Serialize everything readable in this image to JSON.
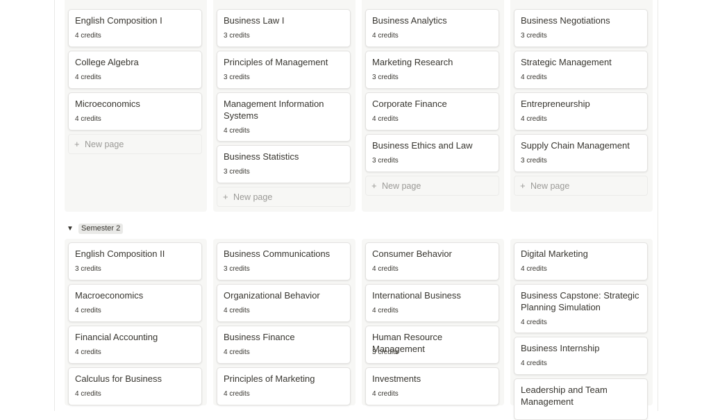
{
  "group2": {
    "label": "Semester 2"
  },
  "new_page_label": "New page",
  "semester1": {
    "col1": [
      {
        "title": "English Composition I",
        "credits": "4 credits"
      },
      {
        "title": "College Algebra",
        "credits": "4 credits"
      },
      {
        "title": "Microeconomics",
        "credits": "4 credits"
      }
    ],
    "col2": [
      {
        "title": "Business Law I",
        "credits": "3 credits"
      },
      {
        "title": "Principles of Management",
        "credits": "3 credits"
      },
      {
        "title": "Management Information Systems",
        "credits": "4 credits"
      },
      {
        "title": "Business Statistics",
        "credits": "3 credits"
      }
    ],
    "col3": [
      {
        "title": "Business Analytics",
        "credits": "4 credits"
      },
      {
        "title": "Marketing Research",
        "credits": "3 credits"
      },
      {
        "title": "Corporate Finance",
        "credits": "4 credits"
      },
      {
        "title": "Business Ethics and Law",
        "credits": "3 credits"
      }
    ],
    "col4": [
      {
        "title": "Business Negotiations",
        "credits": "3 credits"
      },
      {
        "title": "Strategic Management",
        "credits": "4 credits"
      },
      {
        "title": "Entrepreneurship",
        "credits": "4 credits"
      },
      {
        "title": "Supply Chain Management",
        "credits": "3 credits"
      }
    ]
  },
  "semester2": {
    "col1": [
      {
        "title": "English Composition II",
        "credits": "3 credits"
      },
      {
        "title": "Macroeconomics",
        "credits": "4 credits"
      },
      {
        "title": "Financial Accounting",
        "credits": "4 credits"
      },
      {
        "title": "Calculus for Business",
        "credits": "4 credits"
      }
    ],
    "col2": [
      {
        "title": "Business Communications",
        "credits": "3 credits"
      },
      {
        "title": "Organizational Behavior",
        "credits": "4 credits"
      },
      {
        "title": "Business Finance",
        "credits": "4 credits"
      },
      {
        "title": "Principles of Marketing",
        "credits": "4 credits"
      }
    ],
    "col3": [
      {
        "title": "Consumer Behavior",
        "credits": "4 credits"
      },
      {
        "title": "International Business",
        "credits": "4 credits"
      },
      {
        "title": "Human Resource Management",
        "credits": "3 credits"
      },
      {
        "title": "Investments",
        "credits": "4 credits"
      }
    ],
    "col4": [
      {
        "title": "Digital Marketing",
        "credits": "4 credits"
      },
      {
        "title": "Business Capstone: Strategic Planning Simulation",
        "credits": "4 credits"
      },
      {
        "title": "Business Internship",
        "credits": "4 credits"
      },
      {
        "title": "Leadership and Team Management",
        "credits": ""
      }
    ]
  }
}
